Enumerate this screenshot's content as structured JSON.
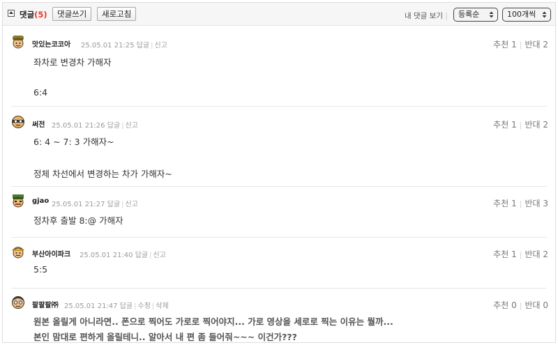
{
  "header": {
    "title": "댓글",
    "count": "(5)",
    "write_label": "댓글쓰기",
    "refresh_label": "새로고침",
    "my_comments_label": "내 댓글 보기",
    "sort_value": "등록순",
    "page_size_value": "100개씩"
  },
  "labels": {
    "reply": "답글",
    "report": "신고",
    "edit": "수정",
    "delete": "삭제",
    "up": "추천",
    "down": "반대"
  },
  "comments": [
    {
      "author": "맛있는코코아",
      "datetime": "25.05.01 21:25",
      "up": "1",
      "down": "2",
      "lines": [
        "좌차로 변경차 가해자",
        "6:4"
      ]
    },
    {
      "author": "써전",
      "datetime": "25.05.01 21:26",
      "up": "1",
      "down": "2",
      "lines": [
        "6: 4 ~ 7: 3 가해자~",
        "정체 차선에서 변경하는 차가 가해자~"
      ]
    },
    {
      "author": "gjao",
      "datetime": "25.05.01 21:27",
      "up": "1",
      "down": "3",
      "lines": [
        "정차후 출발 8:@ 가해자"
      ]
    },
    {
      "author": "부산아이파크",
      "datetime": "25.05.01 21:40",
      "up": "1",
      "down": "2",
      "lines": [
        "5:5"
      ]
    },
    {
      "author": "팔팔팔㈜",
      "datetime": "25.05.01 21:47",
      "up": "0",
      "down": "0",
      "lines": [
        "원본 올릴게 아니라면.. 폰으로 찍어도 가로로 찍어야지... 가로 영상을 세로로 찍는 이유는 뭘까...",
        "본인 맘대로 편하게 올릴테니.. 알아서 내 편 좀 들어줘~~~ 이건가???"
      ]
    }
  ]
}
